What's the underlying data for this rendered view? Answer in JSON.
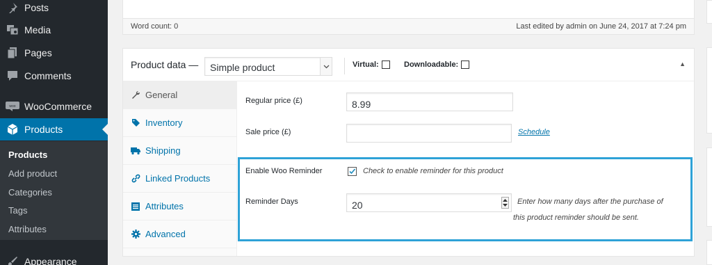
{
  "sidebar": {
    "items": [
      {
        "label": "Posts",
        "icon": "pushpin-icon"
      },
      {
        "label": "Media",
        "icon": "media-icon"
      },
      {
        "label": "Pages",
        "icon": "pages-icon"
      },
      {
        "label": "Comments",
        "icon": "comments-icon"
      },
      {
        "label": "WooCommerce",
        "icon": "woo-icon"
      },
      {
        "label": "Products",
        "icon": "products-icon"
      },
      {
        "label": "Appearance",
        "icon": "appearance-icon"
      }
    ],
    "submenu": [
      "Products",
      "Add product",
      "Categories",
      "Tags",
      "Attributes"
    ]
  },
  "editor": {
    "word_count": "Word count: 0",
    "last_edited": "Last edited by admin on June 24, 2017 at 7:24 pm"
  },
  "product_data": {
    "title": "Product data —",
    "type_value": "Simple product",
    "virtual_label": "Virtual:",
    "downloadable_label": "Downloadable:",
    "virtual_checked": false,
    "downloadable_checked": false,
    "tabs": [
      {
        "label": "General",
        "icon": "wrench-icon"
      },
      {
        "label": "Inventory",
        "icon": "tag-icon"
      },
      {
        "label": "Shipping",
        "icon": "truck-icon"
      },
      {
        "label": "Linked Products",
        "icon": "link-icon"
      },
      {
        "label": "Attributes",
        "icon": "list-icon"
      },
      {
        "label": "Advanced",
        "icon": "gear-icon"
      }
    ],
    "active_tab": "General",
    "fields": {
      "regular_price_label": "Regular price (£)",
      "regular_price_value": "8.99",
      "sale_price_label": "Sale price (£)",
      "sale_price_value": "",
      "schedule_link": "Schedule",
      "woo_reminder_label": "Enable Woo Reminder",
      "woo_reminder_checked": true,
      "woo_reminder_desc": "Check to enable reminder for this product",
      "reminder_days_label": "Reminder Days",
      "reminder_days_value": "20",
      "reminder_days_desc_1": "Enter how many days after the purchase of",
      "reminder_days_desc_2": "this product reminder should be sent."
    }
  },
  "colors": {
    "sidebar_bg": "#23282d",
    "accent": "#0073aa",
    "highlight": "#2ea2d7"
  }
}
